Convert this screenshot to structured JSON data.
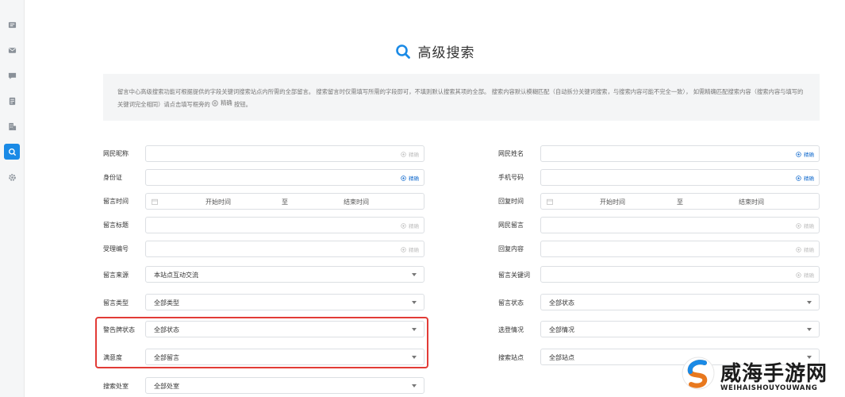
{
  "sidebar": {
    "items": [
      {
        "icon": "news-icon"
      },
      {
        "icon": "mail-icon"
      },
      {
        "icon": "chat-icon"
      },
      {
        "icon": "document-icon"
      },
      {
        "icon": "building-icon"
      },
      {
        "icon": "search-icon",
        "active": true
      },
      {
        "icon": "gear-icon"
      }
    ]
  },
  "header": {
    "title": "高级搜索"
  },
  "notice": {
    "text": "留言中心高级搜索功能可根据提供的字段关键词搜索站点内所需的全部留言。 搜索留言时仅需填写所需的字段即可，不填则默认搜索其项的全部。 搜索内容默认模糊匹配（自动拆分关键词搜索，与搜索内容可能不完全一致）， 如需精确匹配搜索内容（搜索内容与填写的关键词完全相同）请点击填写框旁的",
    "precise_label": "精确",
    "suffix": "按钮。"
  },
  "form": {
    "precise_label": "精确",
    "date_start": "开始时间",
    "date_to": "至",
    "date_end": "结束时间",
    "left": {
      "netizen_nickname": "网民昵称",
      "id_card": "身份证",
      "message_time": "留言时间",
      "message_title": "留言标题",
      "accept_number": "受理编号",
      "message_source": "留言来源",
      "message_source_value": "本站点互动交流",
      "message_type": "留言类型",
      "message_type_value": "全部类型",
      "warning_status": "警告牌状态",
      "warning_status_value": "全部状态",
      "satisfaction": "满意度",
      "satisfaction_value": "全部留言",
      "search_office": "搜索处室",
      "search_office_value": "全部处室"
    },
    "right": {
      "netizen_name": "网民姓名",
      "phone_number": "手机号码",
      "reply_time": "回复时间",
      "netizen_message": "网民留言",
      "reply_content": "回复内容",
      "message_keyword": "留言关键词",
      "message_status": "留言状态",
      "message_status_value": "全部状态",
      "selection": "选登情况",
      "selection_value": "全部情况",
      "search_site": "搜索站点",
      "search_site_value": "全部站点"
    }
  },
  "watermark": {
    "cn": "威海手游网",
    "en": "WEIHAISHOUYOUWANG"
  },
  "colors": {
    "accent": "#1a8ae6",
    "highlight_border": "#e23b36",
    "notice_bg": "#f4f5f6"
  }
}
